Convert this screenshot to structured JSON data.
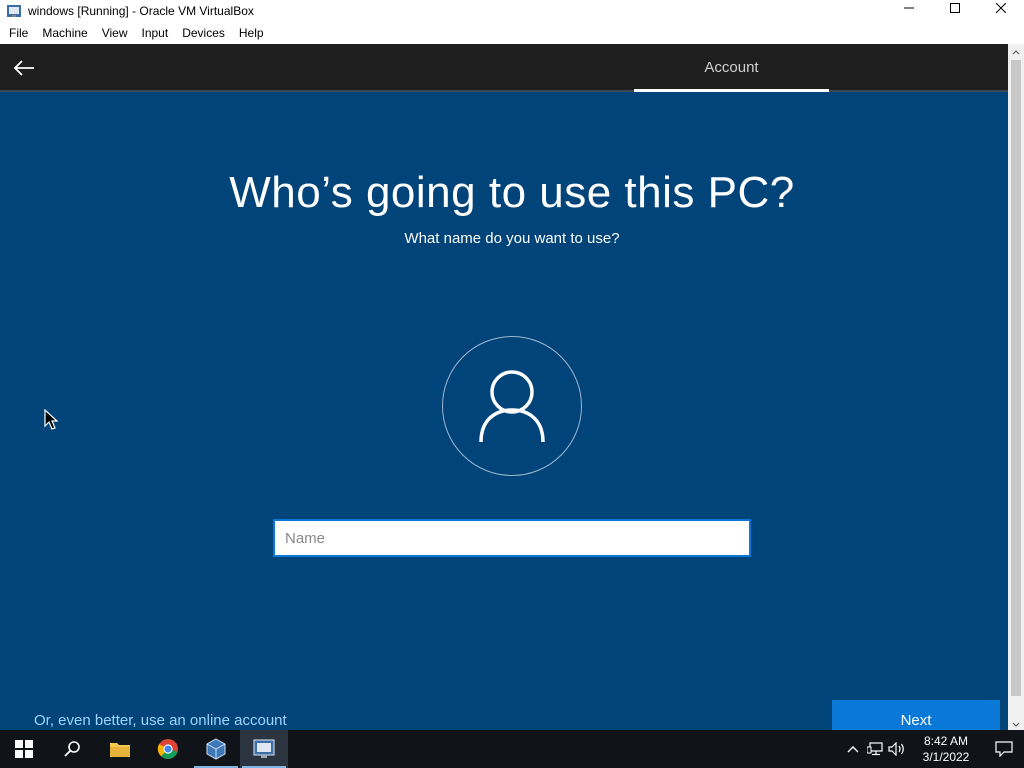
{
  "window": {
    "title": "windows [Running] - Oracle VM VirtualBox"
  },
  "menu": {
    "items": [
      "File",
      "Machine",
      "View",
      "Input",
      "Devices",
      "Help"
    ]
  },
  "oobe": {
    "tab_label": "Account",
    "heading": "Who’s going to use this PC?",
    "subheading": "What name do you want to use?",
    "name_placeholder": "Name",
    "name_value": "",
    "online_link": "Or, even better, use an online account",
    "next_label": "Next"
  },
  "taskbar": {
    "apps": [
      "start-icon",
      "search-icon",
      "file-explorer-icon",
      "chrome-icon",
      "virtualbox-icon",
      "virtualbox-vm-icon"
    ],
    "clock_time": "8:42 AM",
    "clock_date": "3/1/2022"
  },
  "colors": {
    "oobe_background": "#00447a",
    "header_background": "#1e1e1e",
    "accent": "#0a78d7",
    "link": "#9fd2ff",
    "taskbar": "#101418"
  }
}
